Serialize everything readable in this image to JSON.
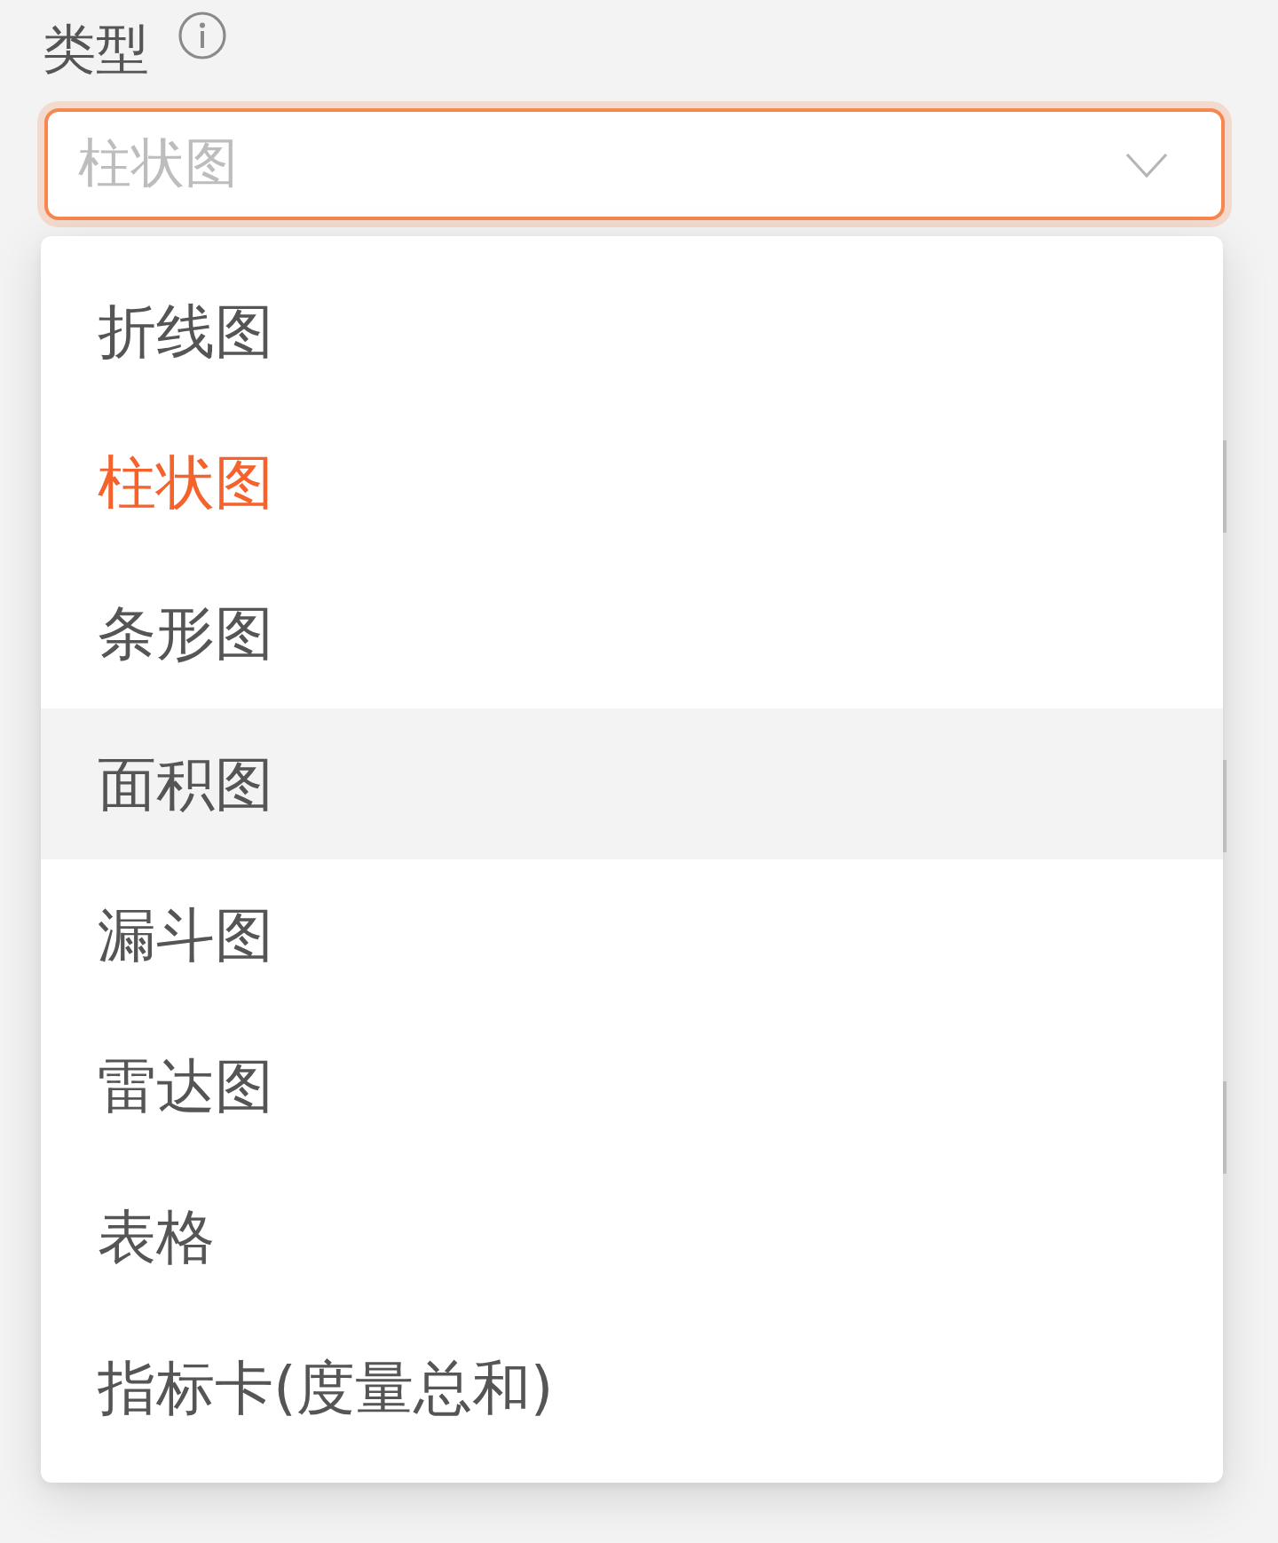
{
  "field": {
    "label": "类型",
    "value": "柱状图",
    "open": true
  },
  "menu": {
    "options": [
      {
        "label": "折线图",
        "selected": false,
        "hovered": false
      },
      {
        "label": "柱状图",
        "selected": true,
        "hovered": false
      },
      {
        "label": "条形图",
        "selected": false,
        "hovered": false
      },
      {
        "label": "面积图",
        "selected": false,
        "hovered": true
      },
      {
        "label": "漏斗图",
        "selected": false,
        "hovered": false
      },
      {
        "label": "雷达图",
        "selected": false,
        "hovered": false
      },
      {
        "label": "表格",
        "selected": false,
        "hovered": false
      },
      {
        "label": "指标卡(度量总和)",
        "selected": false,
        "hovered": false
      }
    ]
  }
}
